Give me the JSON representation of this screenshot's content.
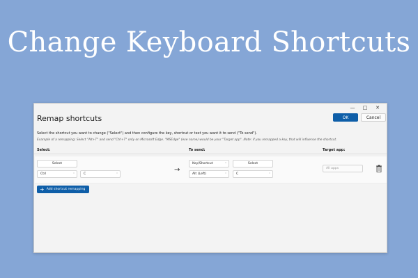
{
  "hero": {
    "title": "Change Keyboard Shortcuts"
  },
  "window_controls": {
    "minimize": "—",
    "maximize": "□",
    "close": "✕"
  },
  "dialog": {
    "title": "Remap shortcuts",
    "ok_label": "OK",
    "cancel_label": "Cancel",
    "instructions": "Select the shortcut you want to change (\"Select\") and then configure the key, shortcut or text you want it to send (\"To send\").",
    "example": "Example of a remapping: Select \"Alt+T\" and send \"Ctrl+T\" only on Microsoft Edge. \"MSEdge\" (exe name) would be your \"Target app\". Note: if you remapped a key, that will influence the shortcut."
  },
  "columns": {
    "select": "Select:",
    "to_send": "To send:",
    "target_app": "Target app:"
  },
  "row": {
    "select_button": "Select",
    "select_modifier": "Ctrl",
    "select_key": "C",
    "send_type": "Key/Shortcut",
    "send_select_button": "Select",
    "send_modifier": "Alt (Left)",
    "send_key": "C",
    "target_placeholder": "All apps"
  },
  "add_button": {
    "label": "Add shortcut remapping"
  },
  "icons": {
    "chevron": "˅",
    "arrow": "→",
    "plus": "+"
  },
  "colors": {
    "background": "#85a6d6",
    "accent": "#0e5ea8"
  }
}
